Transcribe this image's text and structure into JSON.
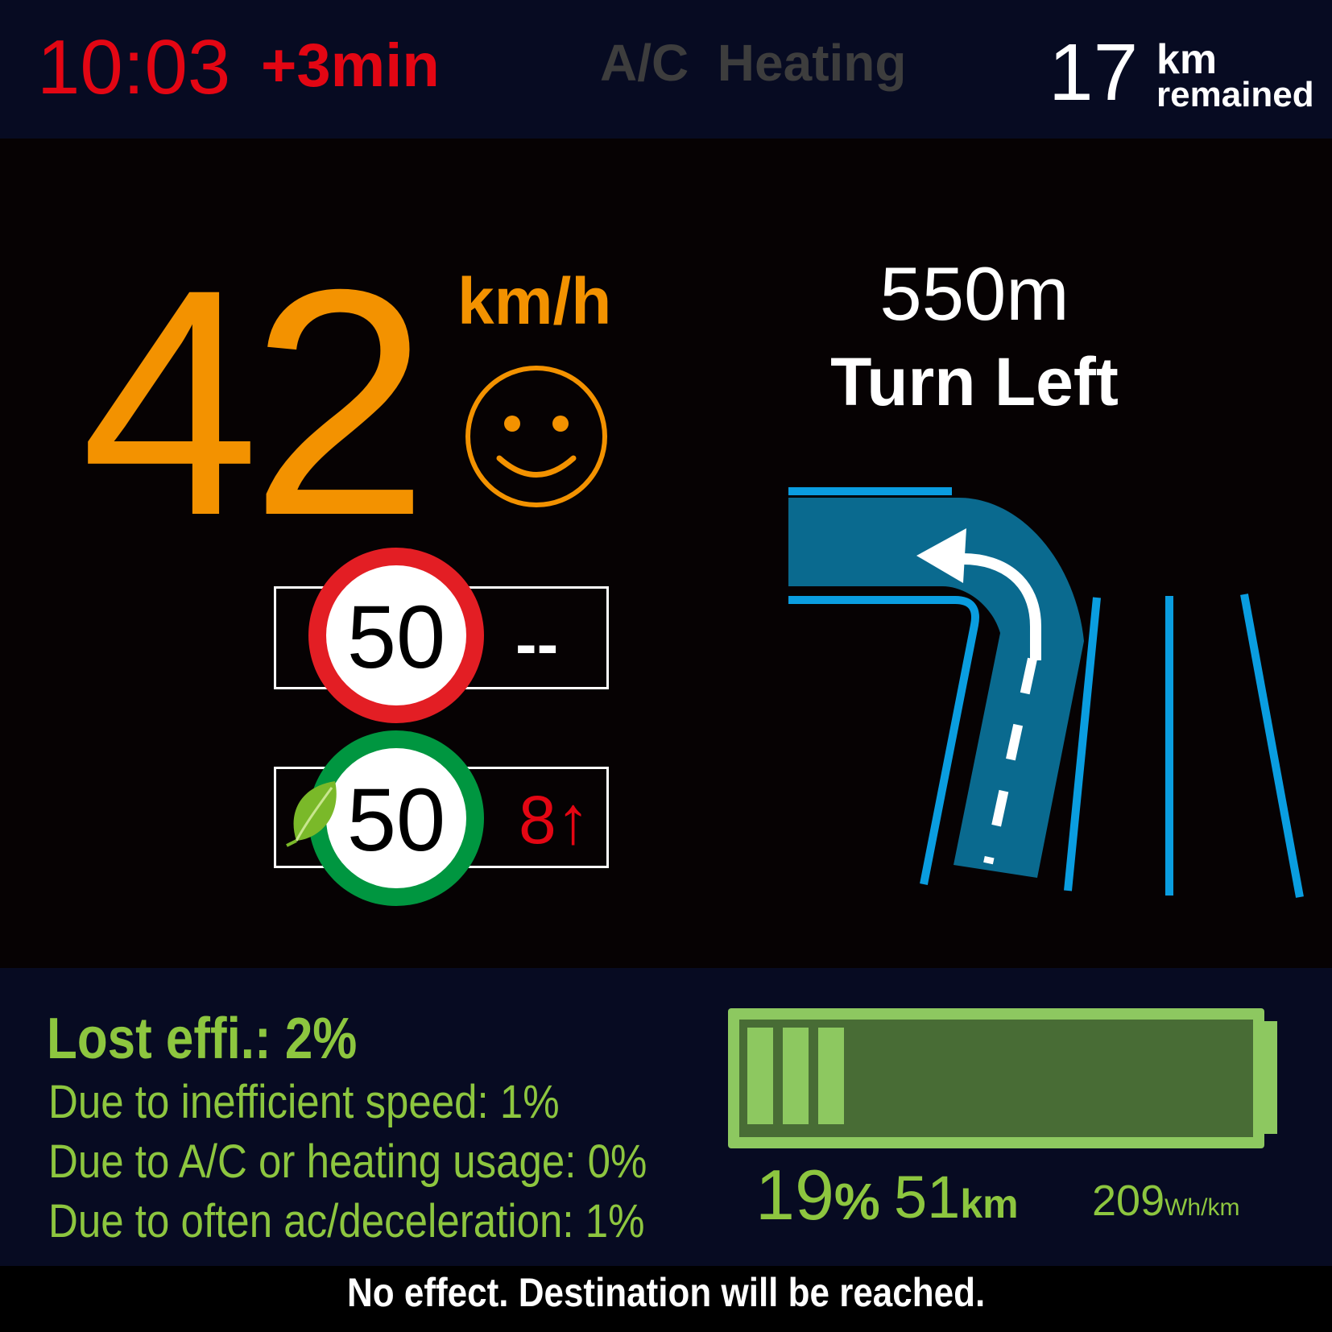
{
  "status": {
    "time": "10:03",
    "delay": "+3min",
    "climate_label": "A/C  Heating",
    "remaining_value": "17",
    "remaining_unit": "km",
    "remaining_label": "remained"
  },
  "speed": {
    "value": "42",
    "unit": "km/h",
    "mood_icon": "smiley-face-icon"
  },
  "limits": {
    "legal_limit": "50",
    "legal_delta": "--",
    "eco_limit": "50",
    "eco_delta": "8",
    "eco_delta_arrow": "↑",
    "eco_icon": "leaf-icon"
  },
  "navigation": {
    "distance": "550m",
    "instruction": "Turn Left",
    "maneuver_icon": "turn-left-arrow-icon"
  },
  "efficiency": {
    "lost_label": "Lost effi.: 2%",
    "reason_speed": "Due to inefficient speed: 1%",
    "reason_climate": "Due to A/C or heating usage: 0%",
    "reason_acceleration": "Due to often ac/deceleration: 1%"
  },
  "battery": {
    "percent_value": "19",
    "percent_sign": "%",
    "range_value": "51",
    "range_unit": "km",
    "consumption_value": "209",
    "consumption_unit": "Wh/km",
    "charge_fraction": 0.19,
    "icon": "battery-icon"
  },
  "footer": {
    "message": "No effect. Destination will be reached."
  },
  "colors": {
    "alert_red": "#e30613",
    "speed_orange": "#f39200",
    "eco_green": "#8dc63f",
    "road_blue": "#0a6a8f",
    "lane_blue": "#0a9de0",
    "sign_red": "#e31e24",
    "sign_green": "#009640"
  }
}
